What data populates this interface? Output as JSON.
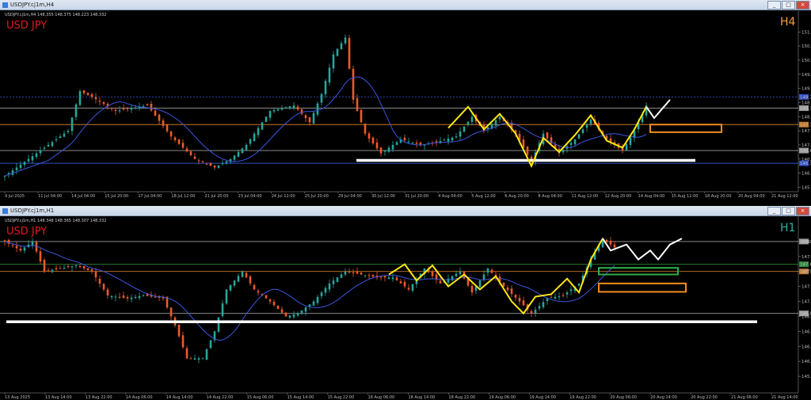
{
  "colors": {
    "bull": "#26a69a",
    "bear": "#ef5a28",
    "ma": "#3b57e0",
    "zig": "#ffe812",
    "proj": "#ffffff",
    "sup": "#ffffff",
    "zoneOrange": "#f08c1e",
    "zoneGreen": "#2fb04a",
    "lvlOrange": "#c8782a",
    "lvlGreen": "#2e8b3d",
    "lvlBlue": "#3050c8",
    "h4label": "#f0a23a",
    "h1label": "#22b8a0"
  },
  "windows": [
    {
      "title": "USDJPY.cj1m,H4",
      "header": "USDJPY.cj1m,H4  148.355 148.375 148.223 148.332",
      "symbol": "USD JPY",
      "timeframe": "H4",
      "buttons": [
        "_",
        "□",
        "×"
      ]
    },
    {
      "title": "USDJPY.cj1m,H1",
      "header": "USDJPY.cj1m,H1  148.348 148.365 148.307 148.332",
      "symbol": "USD JPY",
      "timeframe": "H1",
      "buttons": [
        "_",
        "□",
        "×"
      ]
    }
  ],
  "chart_data": [
    {
      "type": "candlestick",
      "symbol": "USDJPY",
      "timeframe": "H4",
      "ylim": [
        145.4,
        151.4
      ],
      "price_ticks": [
        "151.0",
        "150.5",
        "150.0",
        "149.5",
        "149.0",
        "148.5",
        "148.0",
        "147.5",
        "147.0",
        "146.5",
        "146.0",
        "145.5"
      ],
      "time_ticks": [
        "9 Jul 2025",
        "11 Jul 04:00",
        "14 Jul 04:00",
        "15 Jul 20:00",
        "17 Jul 04:00",
        "18 Jul 12:00",
        "21 Jul 20:00",
        "23 Jul 04:00",
        "24 Jul 12:00",
        "25 Jul 20:00",
        "29 Jul 04:00",
        "30 Jul 12:00",
        "31 Jul 20:00",
        "4 Aug 04:00",
        "5 Aug 12:00",
        "6 Aug 20:00",
        "8 Aug 04:00",
        "11 Aug 12:00",
        "12 Aug 20:00",
        "14 Aug 04:00",
        "15 Aug 12:00",
        "18 Aug 20:00",
        "20 Aug 04:00",
        "21 Aug 12:00"
      ],
      "close_anchors": [
        [
          0,
          145.9
        ],
        [
          4,
          146.3
        ],
        [
          10,
          146.9
        ],
        [
          16,
          147.5
        ],
        [
          19,
          148.9
        ],
        [
          22,
          148.7
        ],
        [
          28,
          148.2
        ],
        [
          36,
          148.4
        ],
        [
          42,
          147.3
        ],
        [
          48,
          146.5
        ],
        [
          53,
          146.2
        ],
        [
          57,
          146.5
        ],
        [
          61,
          147.0
        ],
        [
          67,
          148.2
        ],
        [
          73,
          148.4
        ],
        [
          77,
          147.8
        ],
        [
          80,
          148.8
        ],
        [
          83,
          150.2
        ],
        [
          86,
          150.8
        ],
        [
          88,
          148.6
        ],
        [
          91,
          147.4
        ],
        [
          95,
          146.7
        ],
        [
          100,
          147.2
        ],
        [
          105,
          147.0
        ],
        [
          109,
          147.1
        ],
        [
          114,
          147.3
        ],
        [
          118,
          148.0
        ],
        [
          121,
          147.5
        ],
        [
          125,
          148.0
        ],
        [
          129,
          147.4
        ],
        [
          133,
          146.4
        ],
        [
          136,
          147.4
        ],
        [
          140,
          146.7
        ],
        [
          144,
          147.2
        ],
        [
          148,
          147.9
        ],
        [
          152,
          147.2
        ],
        [
          156,
          146.8
        ],
        [
          159,
          147.5
        ],
        [
          162,
          148.4
        ]
      ],
      "levels": [
        {
          "label": "148.7",
          "price": 148.7,
          "style": "dash",
          "color": "#3050c8"
        },
        {
          "label": "148.3",
          "price": 148.3,
          "style": "solid",
          "color": "#9e9e9e"
        },
        {
          "label": "147.7",
          "price": 147.72,
          "style": "solid",
          "color": "#c8782a"
        },
        {
          "label": "146.8",
          "price": 146.8,
          "style": "solid",
          "color": "#9e9e9e"
        },
        {
          "label": "146.3",
          "price": 146.35,
          "style": "solid",
          "color": "#3050c8"
        }
      ],
      "support_line": 146.45,
      "zigzag": [
        [
          112,
          147.6
        ],
        [
          117,
          148.35
        ],
        [
          121,
          147.55
        ],
        [
          125,
          148.1
        ],
        [
          129,
          147.4
        ],
        [
          133,
          146.25
        ],
        [
          136,
          147.25
        ],
        [
          140,
          146.75
        ],
        [
          144,
          147.35
        ],
        [
          148,
          148.05
        ],
        [
          152,
          147.15
        ],
        [
          156,
          146.9
        ],
        [
          159,
          147.55
        ],
        [
          162,
          148.35
        ]
      ],
      "projection": [
        [
          162,
          148.35
        ],
        [
          164,
          147.95
        ],
        [
          168,
          148.6
        ]
      ],
      "zone": {
        "from": 163,
        "to": 181,
        "top": 147.72,
        "bottom": 147.45,
        "color": "#f08c1e"
      }
    },
    {
      "type": "candlestick",
      "symbol": "USDJPY",
      "timeframe": "H1",
      "ylim": [
        145.5,
        148.25
      ],
      "price_ticks": [
        "148.0",
        "147.75",
        "147.5",
        "147.25",
        "147.0",
        "146.75",
        "146.5",
        "146.25",
        "146.0",
        "145.75"
      ],
      "time_ticks": [
        "13 Aug 2025",
        "13 Aug 14:00",
        "13 Aug 22:00",
        "14 Aug 06:00",
        "14 Aug 14:00",
        "14 Aug 22:00",
        "15 Aug 06:00",
        "15 Aug 14:00",
        "15 Aug 22:00",
        "18 Aug 06:00",
        "18 Aug 14:00",
        "18 Aug 22:00",
        "19 Aug 06:00",
        "19 Aug 14:00",
        "19 Aug 22:00",
        "20 Aug 06:00",
        "20 Aug 14:00",
        "20 Aug 22:00",
        "21 Aug 06:00",
        "21 Aug 14:00"
      ],
      "close_anchors": [
        [
          0,
          148.0
        ],
        [
          4,
          147.85
        ],
        [
          7,
          148.0
        ],
        [
          10,
          147.5
        ],
        [
          14,
          147.55
        ],
        [
          18,
          147.6
        ],
        [
          22,
          147.5
        ],
        [
          26,
          147.1
        ],
        [
          31,
          147.05
        ],
        [
          35,
          147.1
        ],
        [
          40,
          147.05
        ],
        [
          43,
          146.6
        ],
        [
          46,
          146.05
        ],
        [
          50,
          146.05
        ],
        [
          53,
          146.5
        ],
        [
          56,
          147.2
        ],
        [
          60,
          147.5
        ],
        [
          63,
          147.2
        ],
        [
          67,
          147.0
        ],
        [
          71,
          146.75
        ],
        [
          74,
          146.8
        ],
        [
          78,
          147.0
        ],
        [
          82,
          147.3
        ],
        [
          86,
          147.5
        ],
        [
          90,
          147.45
        ],
        [
          94,
          147.4
        ],
        [
          98,
          147.4
        ],
        [
          102,
          147.2
        ],
        [
          106,
          147.55
        ],
        [
          110,
          147.3
        ],
        [
          115,
          147.5
        ],
        [
          118,
          147.15
        ],
        [
          122,
          147.55
        ],
        [
          126,
          147.25
        ],
        [
          130,
          147.0
        ],
        [
          133,
          146.8
        ],
        [
          137,
          147.05
        ],
        [
          141,
          147.1
        ],
        [
          145,
          147.3
        ],
        [
          148,
          147.7
        ],
        [
          151,
          148.05
        ],
        [
          154,
          147.9
        ]
      ],
      "levels": [
        {
          "label": "148.0",
          "price": 148.0,
          "style": "solid",
          "color": "#9e9e9e"
        },
        {
          "label": "147.6",
          "price": 147.62,
          "style": "solid",
          "color": "#2e8b3d"
        },
        {
          "label": "147.5",
          "price": 147.5,
          "style": "solid",
          "color": "#c8782a"
        },
        {
          "label": "146.8",
          "price": 146.8,
          "style": "solid",
          "color": "#9e9e9e"
        }
      ],
      "support_line": 146.66,
      "zigzag": [
        [
          97,
          147.45
        ],
        [
          101,
          147.62
        ],
        [
          104,
          147.35
        ],
        [
          108,
          147.6
        ],
        [
          112,
          147.25
        ],
        [
          116,
          147.45
        ],
        [
          120,
          147.2
        ],
        [
          124,
          147.42
        ],
        [
          128,
          147.0
        ],
        [
          131,
          146.8
        ],
        [
          134,
          147.08
        ],
        [
          138,
          147.12
        ],
        [
          142,
          147.38
        ],
        [
          145,
          147.15
        ],
        [
          148,
          147.7
        ],
        [
          151,
          148.05
        ]
      ],
      "projection": [
        [
          151,
          148.05
        ],
        [
          153,
          147.85
        ],
        [
          157,
          147.95
        ],
        [
          160,
          147.7
        ],
        [
          163,
          147.85
        ],
        [
          165,
          147.7
        ],
        [
          168,
          147.95
        ],
        [
          171,
          148.05
        ]
      ],
      "zones": [
        {
          "from": 150,
          "to": 170,
          "top": 147.56,
          "bottom": 147.45,
          "color": "#2fb04a"
        },
        {
          "from": 150,
          "to": 172,
          "top": 147.3,
          "bottom": 147.16,
          "color": "#f08c1e"
        }
      ]
    }
  ]
}
